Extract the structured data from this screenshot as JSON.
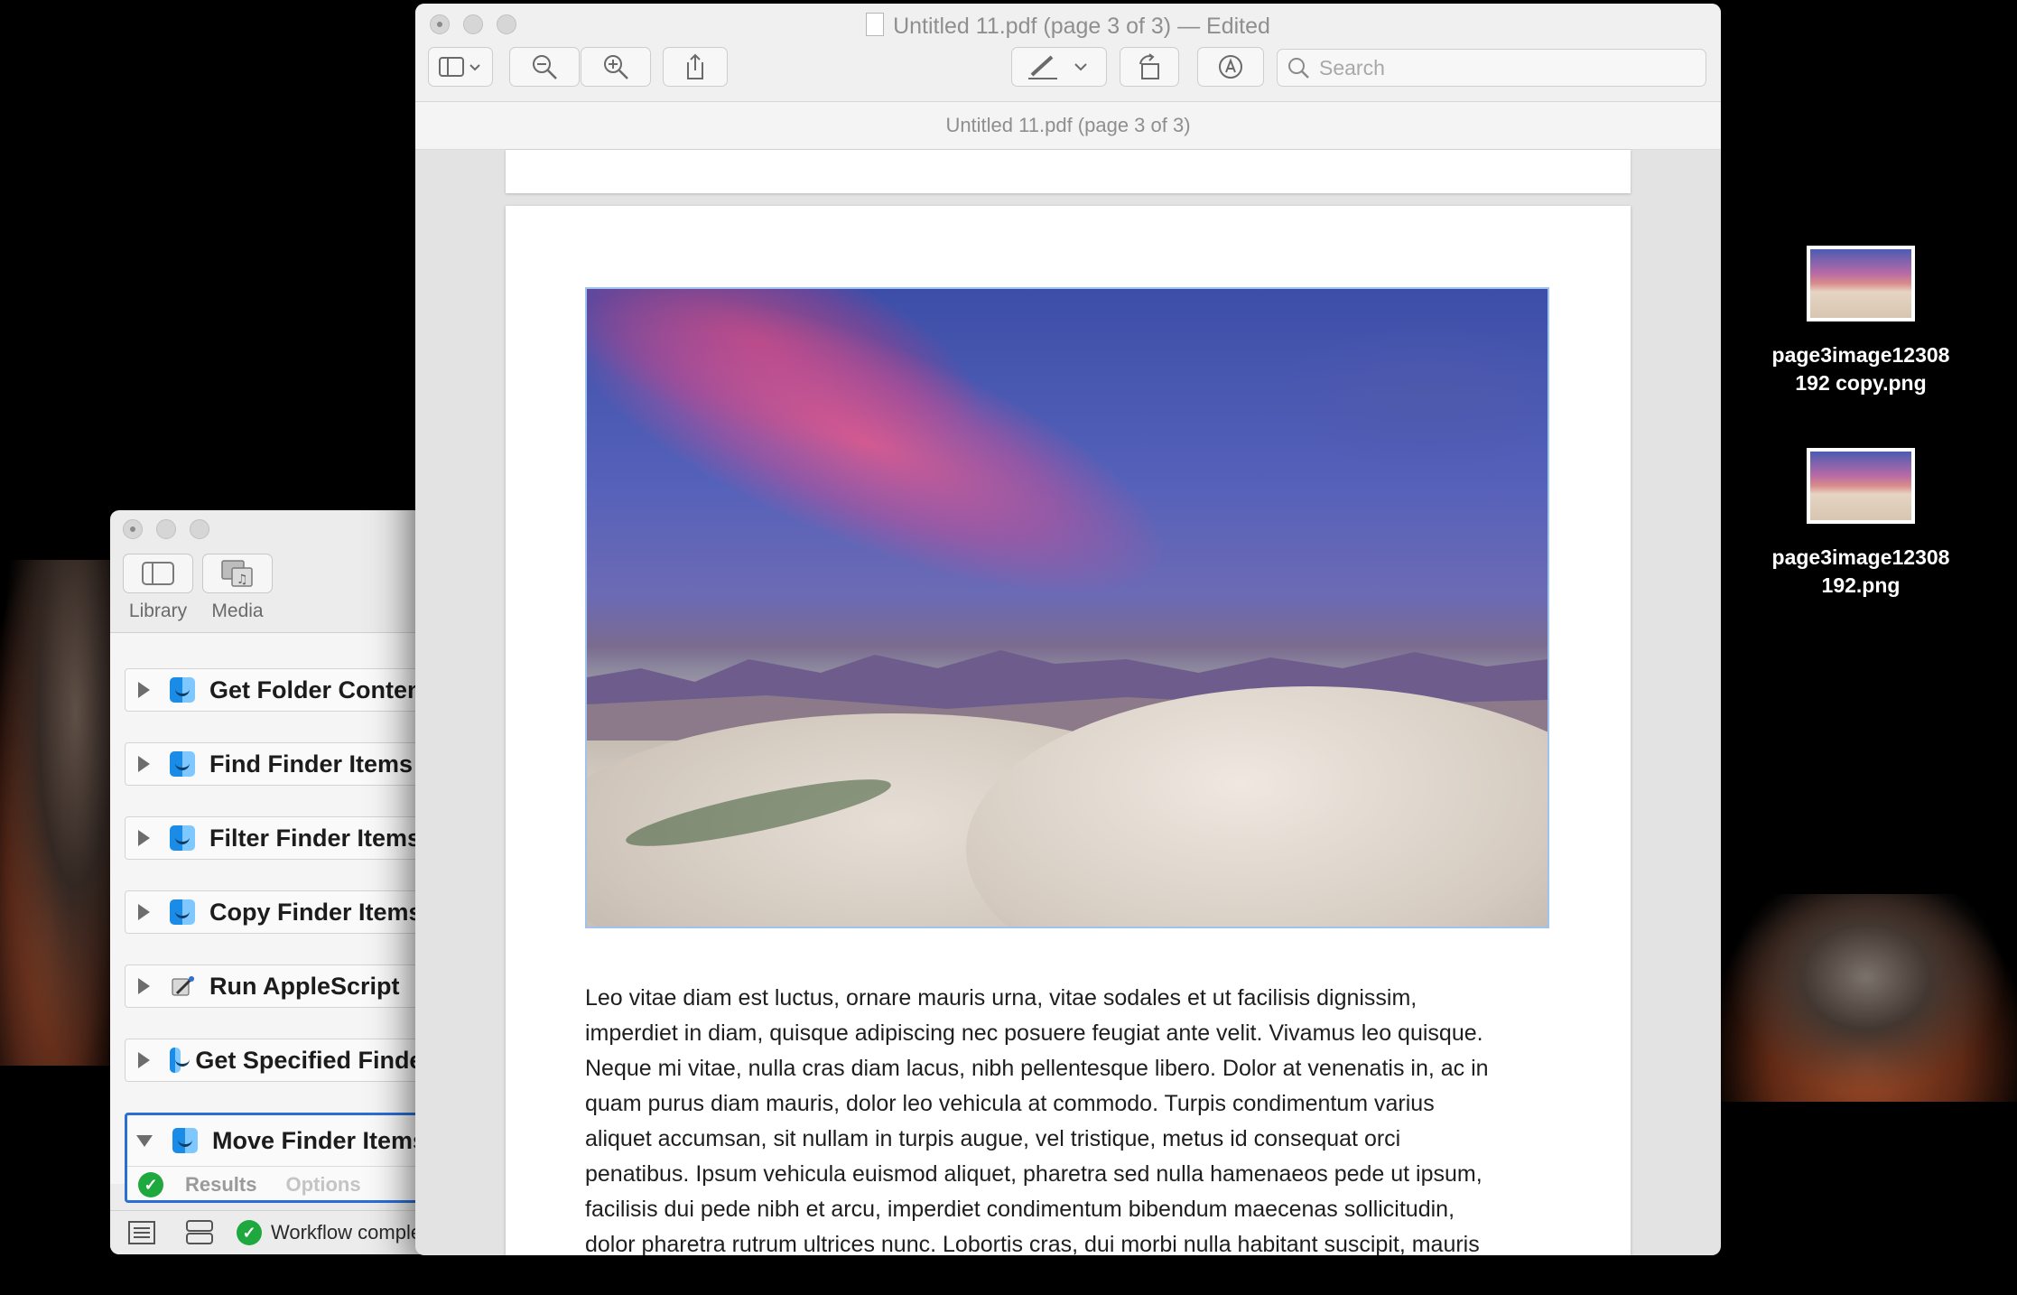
{
  "automator": {
    "toolbar": {
      "library_label": "Library",
      "media_label": "Media"
    },
    "actions": [
      {
        "label": "Get Folder Contents",
        "icon": "finder-icon"
      },
      {
        "label": "Find Finder Items",
        "icon": "finder-icon"
      },
      {
        "label": "Filter Finder Items",
        "icon": "finder-icon"
      },
      {
        "label": "Copy Finder Items",
        "icon": "finder-icon"
      },
      {
        "label": "Run AppleScript",
        "icon": "script-icon"
      },
      {
        "label": "Get Specified Finder Items",
        "icon": "finder-icon"
      }
    ],
    "selected_action": {
      "label": "Move Finder Items",
      "results_tab": "Results",
      "options_tab": "Options"
    },
    "status_text": "Workflow completed"
  },
  "preview": {
    "title": "Untitled 11.pdf (page 3 of 3) — Edited",
    "subtitle": "Untitled 11.pdf (page 3 of 3)",
    "search_placeholder": "Search",
    "body_lines": [
      "Leo vitae diam est luctus, ornare mauris urna, vitae sodales et ut facilisis dignissim,",
      "imperdiet in diam, quisque adipiscing nec posuere feugiat ante velit. Vivamus leo quisque.",
      "Neque mi vitae, nulla cras diam lacus, nibh pellentesque libero. Dolor at venenatis in, ac in",
      "quam purus diam mauris, dolor leo vehicula at commodo. Turpis condimentum varius",
      "aliquet accumsan, sit nullam in turpis augue, vel tristique, metus id consequat orci",
      "penatibus. Ipsum vehicula euismod aliquet, pharetra sed nulla hamenaeos pede ut ipsum,",
      "facilisis dui pede nibh et arcu, imperdiet condimentum bibendum maecenas sollicitudin,",
      "dolor pharetra rutrum ultrices nunc. Lobortis cras, dui morbi nulla habitant suscipit, mauris"
    ]
  },
  "desktop_files": [
    {
      "name_line1": "page3image12308",
      "name_line2": "192 copy.png"
    },
    {
      "name_line1": "page3image12308",
      "name_line2": "192.png"
    }
  ],
  "colors": {
    "selection_blue": "#2a6fd6",
    "success_green": "#1fa83e"
  }
}
